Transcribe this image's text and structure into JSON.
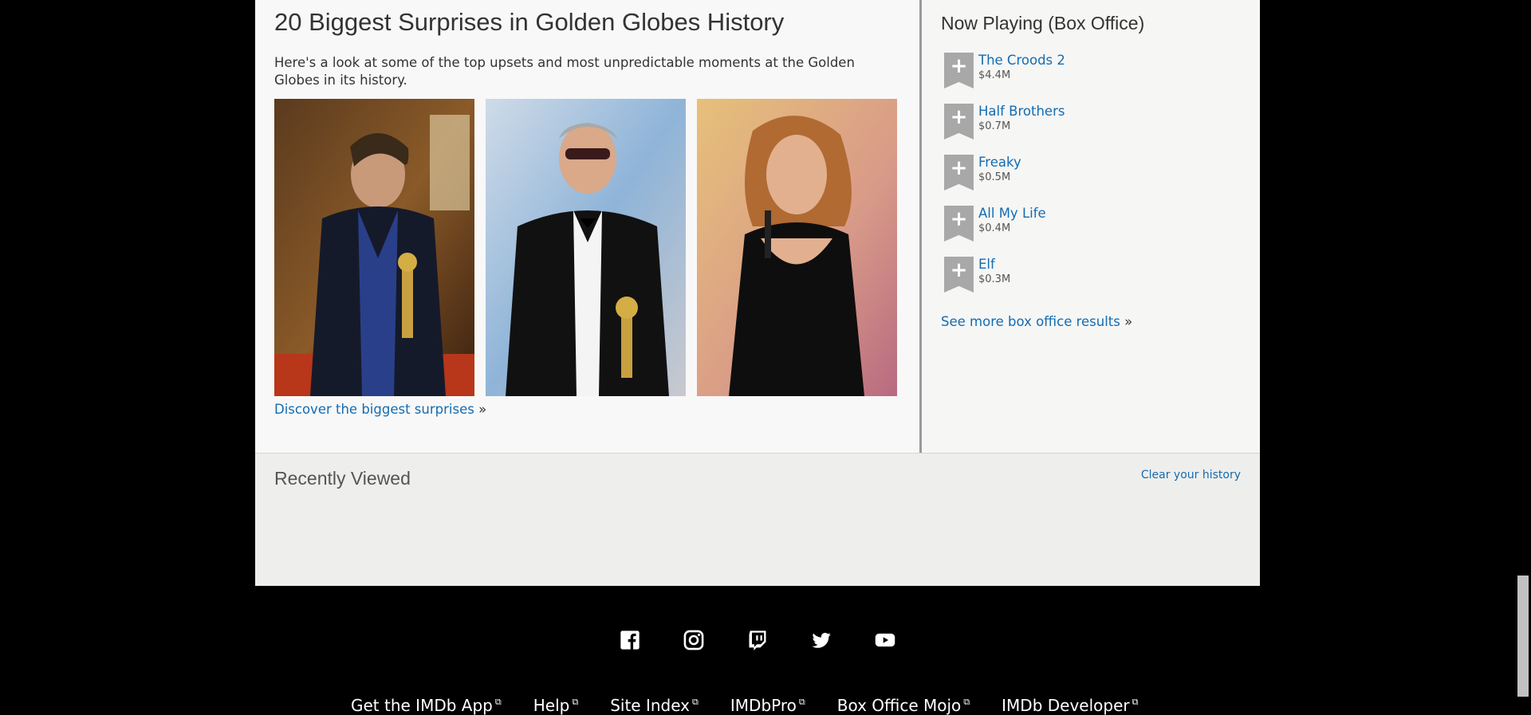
{
  "feature": {
    "title": "20 Biggest Surprises in Golden Globes History",
    "description": "Here's a look at some of the top upsets and most unpredictable moments at the Golden Globes in its history.",
    "link": "Discover the biggest surprises",
    "link_suffix": "»"
  },
  "box_office": {
    "title": "Now Playing (Box Office)",
    "items": [
      {
        "title": "The Croods 2",
        "gross": "$4.4M"
      },
      {
        "title": "Half Brothers",
        "gross": "$0.7M"
      },
      {
        "title": "Freaky",
        "gross": "$0.5M"
      },
      {
        "title": "All My Life",
        "gross": "$0.4M"
      },
      {
        "title": "Elf",
        "gross": "$0.3M"
      }
    ],
    "more_link": "See more box office results",
    "more_suffix": "»",
    "add_glyph": "+"
  },
  "recently_viewed": {
    "title": "Recently Viewed",
    "clear": "Clear your history"
  },
  "social_icons": [
    "facebook-icon",
    "instagram-icon",
    "twitch-icon",
    "twitter-icon",
    "youtube-icon"
  ],
  "footer": {
    "links": [
      "Get the IMDb App",
      "Help",
      "Site Index",
      "IMDbPro",
      "Box Office Mojo",
      "IMDb Developer"
    ]
  },
  "colors": {
    "link": "#136cb2",
    "page_bg": "#f8f8f8",
    "body_bg": "#000000"
  }
}
